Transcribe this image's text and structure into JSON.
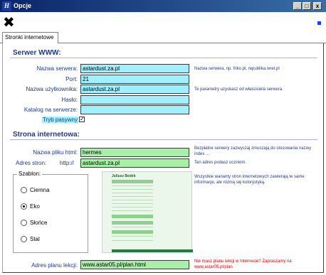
{
  "window": {
    "title": "Opcje",
    "app_icon_letter": "H",
    "minimize_glyph": "_",
    "maximize_glyph": "□",
    "close_glyph": "x"
  },
  "toolbar": {
    "close_glyph": "✖"
  },
  "tabs": [
    {
      "label": "Stronki internetowe"
    }
  ],
  "server": {
    "title": "Serwer WWW:",
    "server_name": {
      "label": "Nazwa serwera:",
      "value": "astardust.za.pl",
      "note": "Nazwa serwera, np. friko.pl, republika.onet.pl"
    },
    "port": {
      "label": "Port:",
      "value": "21"
    },
    "username": {
      "label": "Nazwa użytkownika:",
      "value": "astardust.za.pl",
      "note": "Te parametry uzyskasz od właściciela serwera."
    },
    "password": {
      "label": "Hasło:",
      "value": ""
    },
    "directory": {
      "label": "Katalog na serwerze:",
      "value": ""
    },
    "passive": {
      "label": "Tryb pasywny",
      "checked": true,
      "check_glyph": "✓"
    }
  },
  "website": {
    "title": "Strona internetowa:",
    "filename": {
      "label": "Nazwa pliku html:",
      "value": "hermes",
      "note": "Bezpłatne serwery zazwyczaj zmuszają do stosowania nazwy index ..."
    },
    "address": {
      "label": "Adres stron:",
      "prefix": "http://",
      "value": "astardust.za.pl",
      "note": "Ten adres podasz uczniom."
    },
    "template_note": "Wszystkie warianty stron internetowych zawierają te same informacje, ale różnią się kolorystyką.",
    "template": {
      "legend": "Szablon:",
      "options": [
        {
          "label": "Ciemna",
          "selected": false
        },
        {
          "label": "Eko",
          "selected": true
        },
        {
          "label": "Słońce",
          "selected": false
        },
        {
          "label": "Stal",
          "selected": false
        }
      ]
    },
    "preview_title": "Juliusz Bedek",
    "lesson_plan": {
      "label": "Adres planu lekcji:",
      "value": "www.astar05.pl/plan.html",
      "note": "Nie masz planu lekcji w Internecie? Zapraszamy na www.astar05.pl/plan"
    }
  },
  "colors": {
    "cyan_field": "#a0f0ff",
    "green_field": "#a8f0a8",
    "label_blue": "#1f3a8a",
    "note_red": "#d00000"
  }
}
